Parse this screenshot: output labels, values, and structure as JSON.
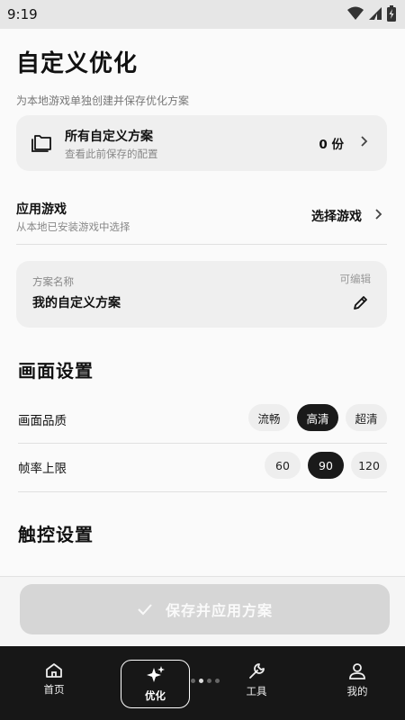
{
  "status_bar": {
    "time": "9:19"
  },
  "page": {
    "title": "自定义优化",
    "subtitle": "为本地游戏单独创建并保存优化方案"
  },
  "all_plans": {
    "title": "所有自定义方案",
    "subtitle": "查看此前保存的配置",
    "count": "0 份"
  },
  "game": {
    "title": "应用游戏",
    "subtitle": "从本地已安装游戏中选择",
    "action": "选择游戏"
  },
  "plan_name": {
    "label": "方案名称",
    "editable": "可编辑",
    "value": "我的自定义方案"
  },
  "display_settings": {
    "title": "画面设置",
    "quality": {
      "label": "画面品质",
      "options": [
        "流畅",
        "高清",
        "超清"
      ],
      "selected": "高清"
    },
    "fps": {
      "label": "帧率上限",
      "options": [
        "60",
        "90",
        "120"
      ],
      "selected": "90"
    }
  },
  "touch_settings": {
    "title": "触控设置"
  },
  "save_button": {
    "label": "保存并应用方案"
  },
  "bottom_nav": {
    "items": [
      {
        "label": "首页",
        "icon": "home-icon"
      },
      {
        "label": "优化",
        "icon": "sparkle-icon",
        "active": true
      },
      {
        "label": "工具",
        "icon": "wrench-icon"
      },
      {
        "label": "我的",
        "icon": "person-icon"
      }
    ]
  },
  "colors": {
    "accent": "#1a1a1a",
    "card": "#efefef",
    "nav_bg": "#171717",
    "save_disabled": "#d6d6d6"
  }
}
